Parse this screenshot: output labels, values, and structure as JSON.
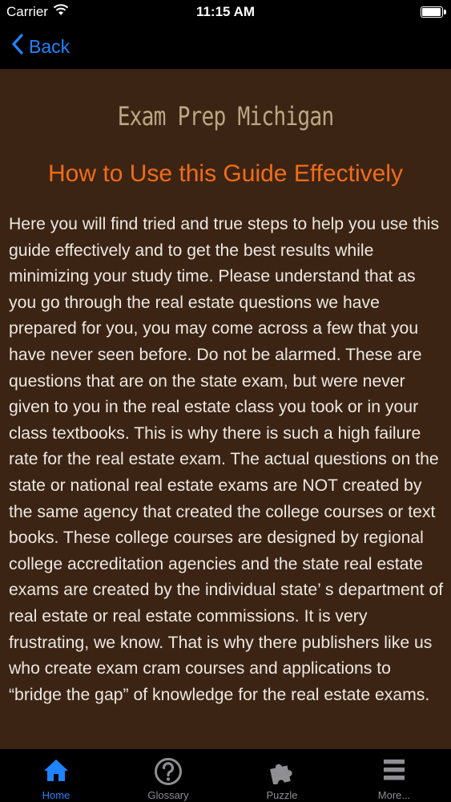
{
  "status_bar": {
    "carrier": "Carrier",
    "time": "11:15 AM"
  },
  "nav": {
    "back_label": "Back"
  },
  "page": {
    "logo_title": "Exam Prep Michigan",
    "heading": "How to Use this Guide Effectively",
    "body": "Here you will find tried and true steps to help you use this guide effectively and to get the best results while minimizing your study time. Please understand that as you go through the real estate questions we have prepared for you, you may come across a few that you have never seen before. Do not be alarmed. These are questions that are on the state exam, but were never given to you in the real estate class you took or in your class textbooks. This is why there is such a high failure rate for the real estate exam. The actual questions on the state or national real estate exams are NOT created by the same agency that created the college courses or text books. These college courses are designed by regional college accreditation agencies and the state real estate exams are created by the individual state’ s department of real estate or real estate commissions. It is very frustrating, we know. That is why there publishers like us who create exam cram courses and applications to “bridge the gap” of knowledge for the real estate exams."
  },
  "tabs": [
    {
      "label": "Home",
      "icon": "home-icon",
      "active": true
    },
    {
      "label": "Glossary",
      "icon": "question-circle-icon",
      "active": false
    },
    {
      "label": "Puzzle",
      "icon": "puzzle-piece-icon",
      "active": false
    },
    {
      "label": "More...",
      "icon": "menu-lines-icon",
      "active": false
    }
  ],
  "colors": {
    "accent": "#1e84ff",
    "content_background": "#3c2414",
    "heading": "#f06d18",
    "logo_text": "#b9a884",
    "inactive_tab": "#8e8e93"
  }
}
